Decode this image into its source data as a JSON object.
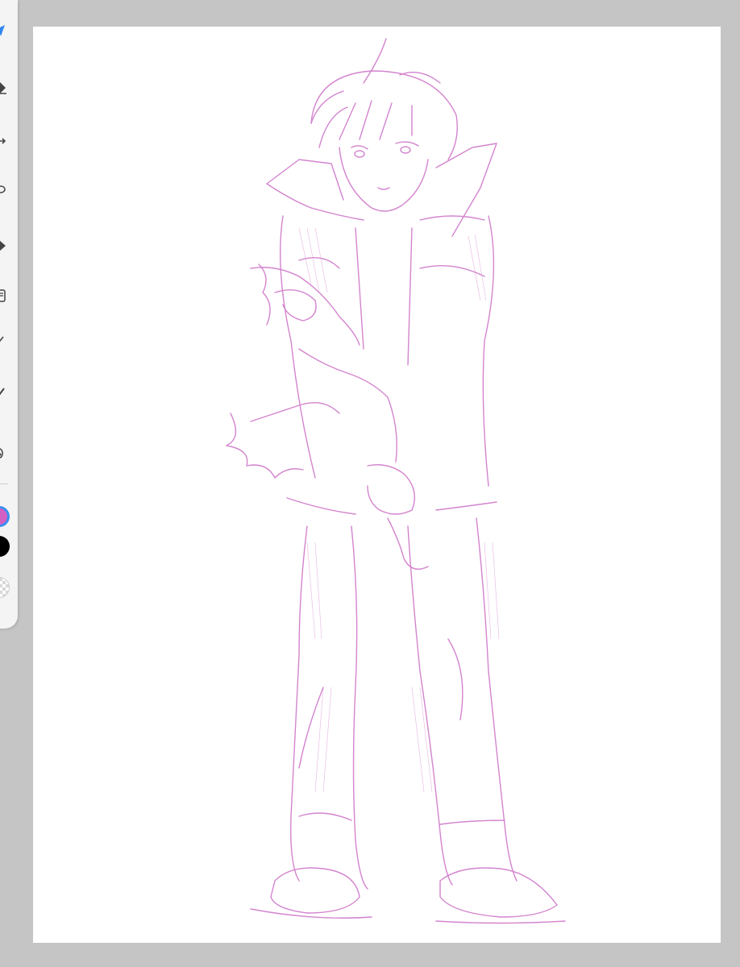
{
  "app": {
    "background_color": "#c5c5c5",
    "canvas_color": "#ffffff"
  },
  "toolbar": {
    "tools": [
      {
        "id": "select",
        "icon": "arrow-cursor-icon",
        "active": true,
        "color": "#2f86ee"
      },
      {
        "id": "eraser",
        "icon": "eraser-icon"
      },
      {
        "id": "move",
        "icon": "move-arrows-icon"
      },
      {
        "id": "lasso",
        "icon": "lasso-icon"
      },
      {
        "id": "fill",
        "icon": "fill-bucket-icon"
      },
      {
        "id": "layers",
        "icon": "layers-icon"
      },
      {
        "id": "line",
        "icon": "line-tool-icon"
      },
      {
        "id": "brush",
        "icon": "brush-icon"
      },
      {
        "id": "blend",
        "icon": "smudge-icon"
      }
    ],
    "colors": {
      "primary": "#d45fc4",
      "secondary": "#000000",
      "active_ring": "#3a8ef0"
    }
  },
  "artwork": {
    "subject": "pencil-sketch-character",
    "stroke_color": "#cf77c9"
  }
}
